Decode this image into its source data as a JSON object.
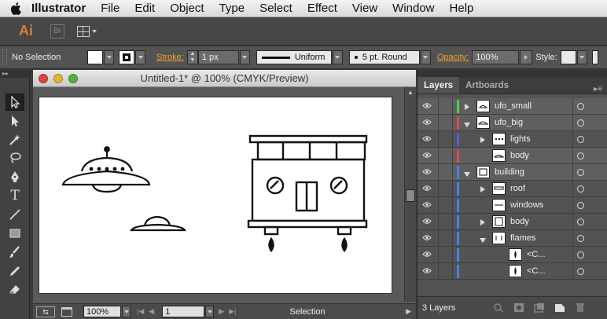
{
  "menubar": {
    "app_name": "Illustrator",
    "items": [
      "File",
      "Edit",
      "Object",
      "Type",
      "Select",
      "Effect",
      "View",
      "Window",
      "Help"
    ]
  },
  "appbar": {
    "ai_label": "Ai",
    "br_label": "Br"
  },
  "control": {
    "selection": "No Selection",
    "stroke_label": "Stroke:",
    "stroke_weight": "1 px",
    "profile": "Uniform",
    "brush": "5 pt. Round",
    "opacity_label": "Opacity:",
    "opacity": "100%",
    "style_label": "Style:"
  },
  "document": {
    "title": "Untitled-1* @ 100% (CMYK/Preview)",
    "zoom": "100%",
    "artboard": "1",
    "status": "Selection"
  },
  "layers_panel": {
    "tab_layers": "Layers",
    "tab_artboards": "Artboards",
    "footer": "3 Layers",
    "rows": [
      {
        "name": "ufo_small",
        "color": "#4fd14f"
      },
      {
        "name": "ufo_big",
        "color": "#e04a4a"
      },
      {
        "name": "lights",
        "color": "#5a5ae0"
      },
      {
        "name": "body",
        "color": "#e04a4a"
      },
      {
        "name": "building",
        "color": "#4a7fe0"
      },
      {
        "name": "roof",
        "color": "#4a7fe0"
      },
      {
        "name": "windows",
        "color": "#4a7fe0"
      },
      {
        "name": "body",
        "color": "#4a7fe0"
      },
      {
        "name": "flames",
        "color": "#4a7fe0"
      },
      {
        "name": "<C...",
        "color": "#4a7fe0"
      },
      {
        "name": "<C...",
        "color": "#4a7fe0"
      }
    ]
  },
  "icons": {
    "tools": [
      "selection-tool-icon",
      "direct-selection-tool-icon",
      "magic-wand-icon",
      "lasso-icon",
      "pen-tool-icon",
      "type-tool-icon",
      "line-tool-icon",
      "rectangle-tool-icon",
      "paintbrush-icon",
      "pencil-icon",
      "eraser-icon"
    ]
  }
}
